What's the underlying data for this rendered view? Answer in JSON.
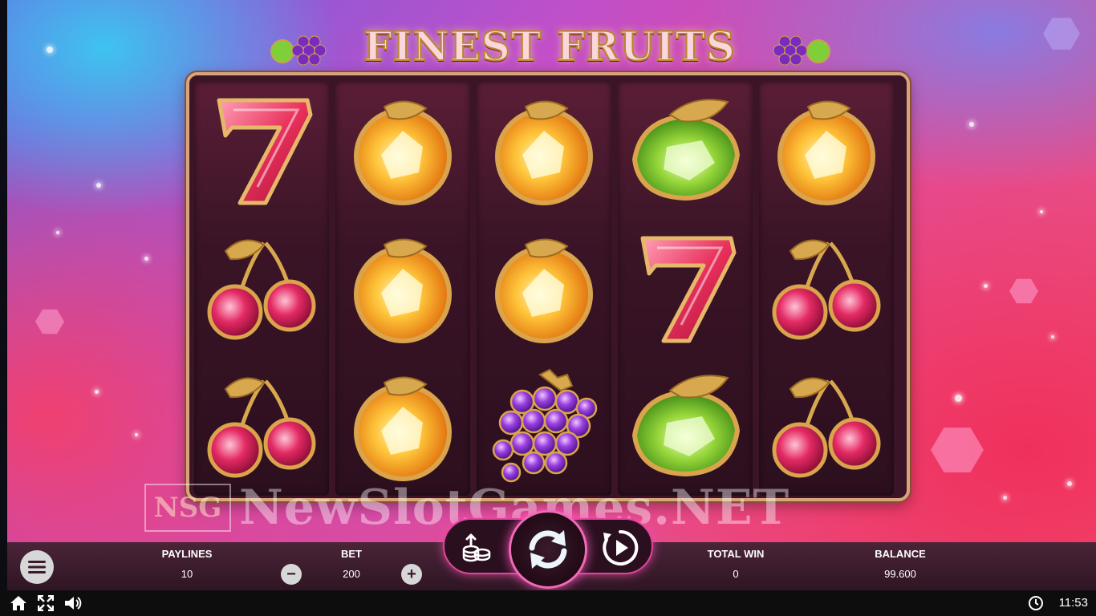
{
  "game": {
    "title": "FINEST FRUITS"
  },
  "reels": [
    [
      "seven",
      "cherries",
      "cherries"
    ],
    [
      "orange",
      "orange",
      "orange"
    ],
    [
      "orange",
      "orange",
      "grapes"
    ],
    [
      "lime",
      "seven",
      "lime"
    ],
    [
      "orange",
      "cherries",
      "cherries"
    ]
  ],
  "watermark": {
    "badge": "NSG",
    "text": "NewSlotGames.NET"
  },
  "controls": {
    "paylines_label": "PAYLINES",
    "paylines_value": "10",
    "bet_label": "BET",
    "bet_value": "200",
    "bet_minus": "−",
    "bet_plus": "+",
    "total_win_label": "TOTAL WIN",
    "total_win_value": "0",
    "balance_label": "BALANCE",
    "balance_value": "99.600"
  },
  "icons": {
    "menu": "hamburger-icon",
    "coins": "coin-stack-icon",
    "spin": "spin-arrows-icon",
    "autoplay": "autoplay-icon",
    "home": "home-icon",
    "fullscreen": "fullscreen-icon",
    "sound": "speaker-icon",
    "clock": "clock-icon"
  },
  "status": {
    "time": "11:53"
  },
  "colors": {
    "accent_pink": "#f06ab6",
    "reel_bg": "#3a1426",
    "frame_gold": "#d8a57a"
  }
}
